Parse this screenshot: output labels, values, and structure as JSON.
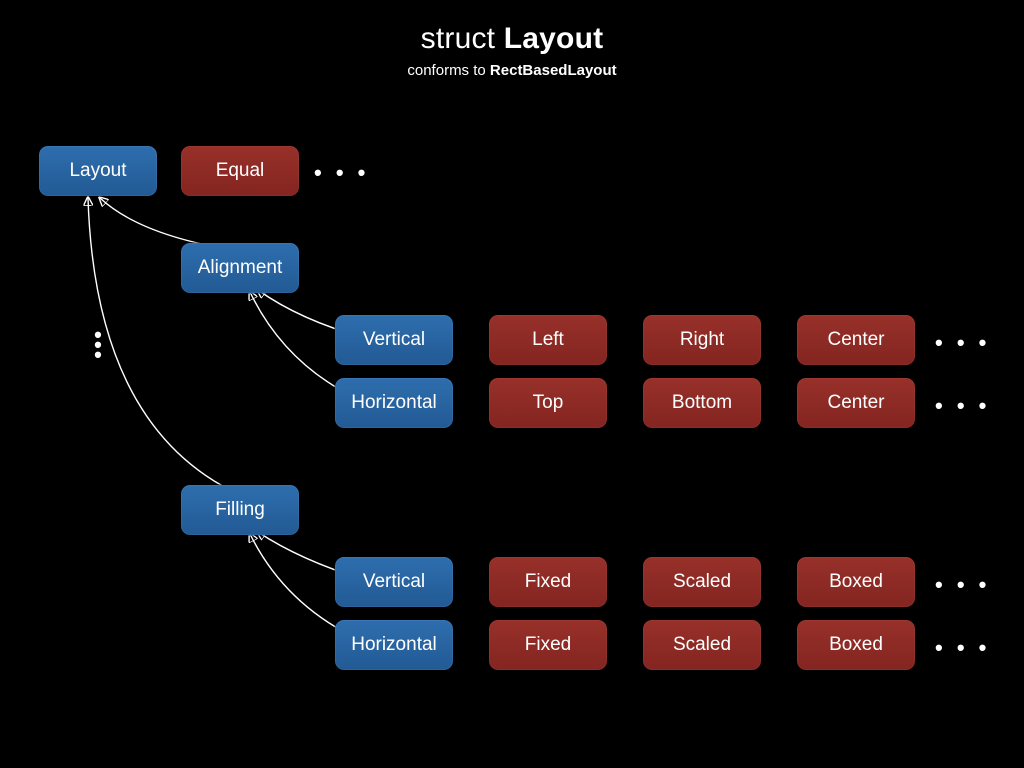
{
  "title": {
    "prefix": "struct",
    "name": "Layout"
  },
  "subtitle": {
    "prefix": "conforms to",
    "name": "RectBasedLayout"
  },
  "ellipsis": "• • •",
  "nodes": {
    "root": "Layout",
    "root_sibling": "Equal",
    "alignment": {
      "label": "Alignment",
      "vertical": {
        "label": "Vertical",
        "options": [
          "Left",
          "Right",
          "Center"
        ]
      },
      "horizontal": {
        "label": "Horizontal",
        "options": [
          "Top",
          "Bottom",
          "Center"
        ]
      }
    },
    "filling": {
      "label": "Filling",
      "vertical": {
        "label": "Vertical",
        "options": [
          "Fixed",
          "Scaled",
          "Boxed"
        ]
      },
      "horizontal": {
        "label": "Horizontal",
        "options": [
          "Fixed",
          "Scaled",
          "Boxed"
        ]
      }
    }
  }
}
